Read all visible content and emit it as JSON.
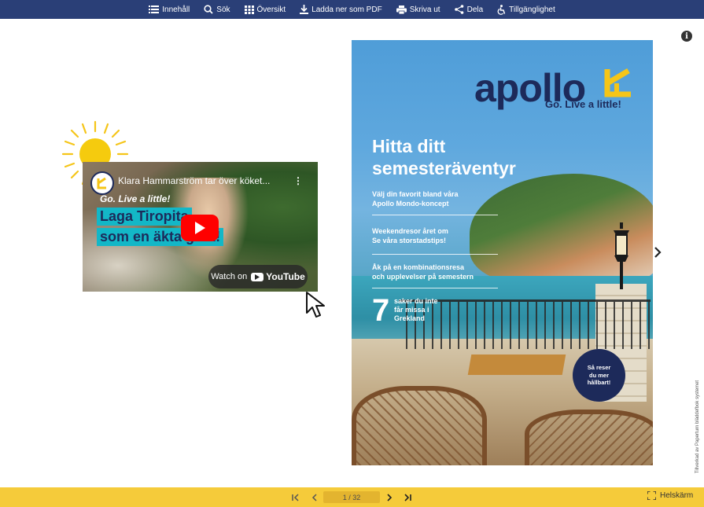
{
  "toolbar": {
    "items": [
      {
        "label": "Innehåll",
        "icon": "menu-icon"
      },
      {
        "label": "Sök",
        "icon": "search-icon"
      },
      {
        "label": "Översikt",
        "icon": "grid-icon"
      },
      {
        "label": "Ladda ner som PDF",
        "icon": "download-icon"
      },
      {
        "label": "Skriva ut",
        "icon": "print-icon"
      },
      {
        "label": "Dela",
        "icon": "share-icon"
      },
      {
        "label": "Tillgänglighet",
        "icon": "accessibility-icon"
      }
    ]
  },
  "video": {
    "title": "Klara Hammarström tar över köket...",
    "overlay_tagline": "Go. Live a little!",
    "headline_line1": "Laga Tiropita",
    "headline_line2": "som en äkta grek!",
    "watch_label": "Watch on",
    "watch_brand": "YouTube"
  },
  "cover": {
    "logo": "apollo",
    "tagline": "Go. Live a little!",
    "headline_line1": "Hitta ditt",
    "headline_line2": "semesteräventyr",
    "line1a": "Välj din favorit bland våra",
    "line1b": "Apollo Mondo-koncept",
    "line2a": "Weekendresor året om",
    "line2b": "Se våra storstadstips!",
    "line3a": "Åk på en kombinationsresa",
    "line3b": "och upplevelser på semestern",
    "seven_number": "7",
    "seven_a": "saker du inte",
    "seven_b": "får missa i",
    "seven_c": "Grekland",
    "badge_a": "Så reser",
    "badge_b": "du mer",
    "badge_c": "hållbart!"
  },
  "credit": "Tillverkad av Paperturn bläddefbok systemet",
  "pager": {
    "page_indicator": "1 / 32",
    "fullscreen_label": "Helskärm"
  },
  "colors": {
    "toolbar_bg": "#2a3f77",
    "bottombar_bg": "#f5cb3a",
    "brand_navy": "#1d2a5a",
    "brand_yellow": "#f5c518",
    "headline_highlight": "#13b7c7"
  }
}
